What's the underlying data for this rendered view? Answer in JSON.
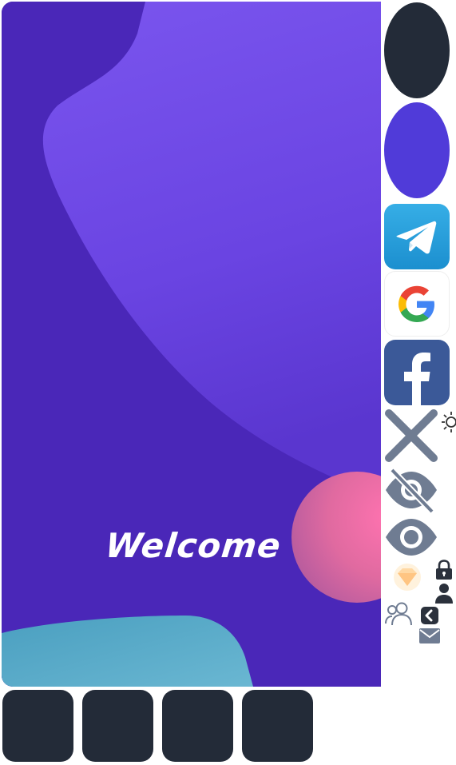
{
  "splash": {
    "welcome_text": "Welcome"
  },
  "colors": {
    "hero_background": "#4a27b8",
    "hero_blob": "#6a4ae8",
    "orb_pink": "#f06aa6",
    "teal_shape": "#4fa6c6",
    "dark_tile": "#232b38",
    "purple_tile": "#503bd9",
    "telegram_blue": "#2aa3dd",
    "facebook_blue": "#3b5998",
    "icon_gray": "#6f7c92"
  },
  "icons": [
    "telegram-icon",
    "google-icon",
    "facebook-icon",
    "close-icon",
    "sun-icon",
    "eye-off-icon",
    "eye-icon",
    "gem-icon",
    "lock-icon",
    "user-icon",
    "users-icon",
    "chevron-left-icon",
    "mail-icon"
  ]
}
